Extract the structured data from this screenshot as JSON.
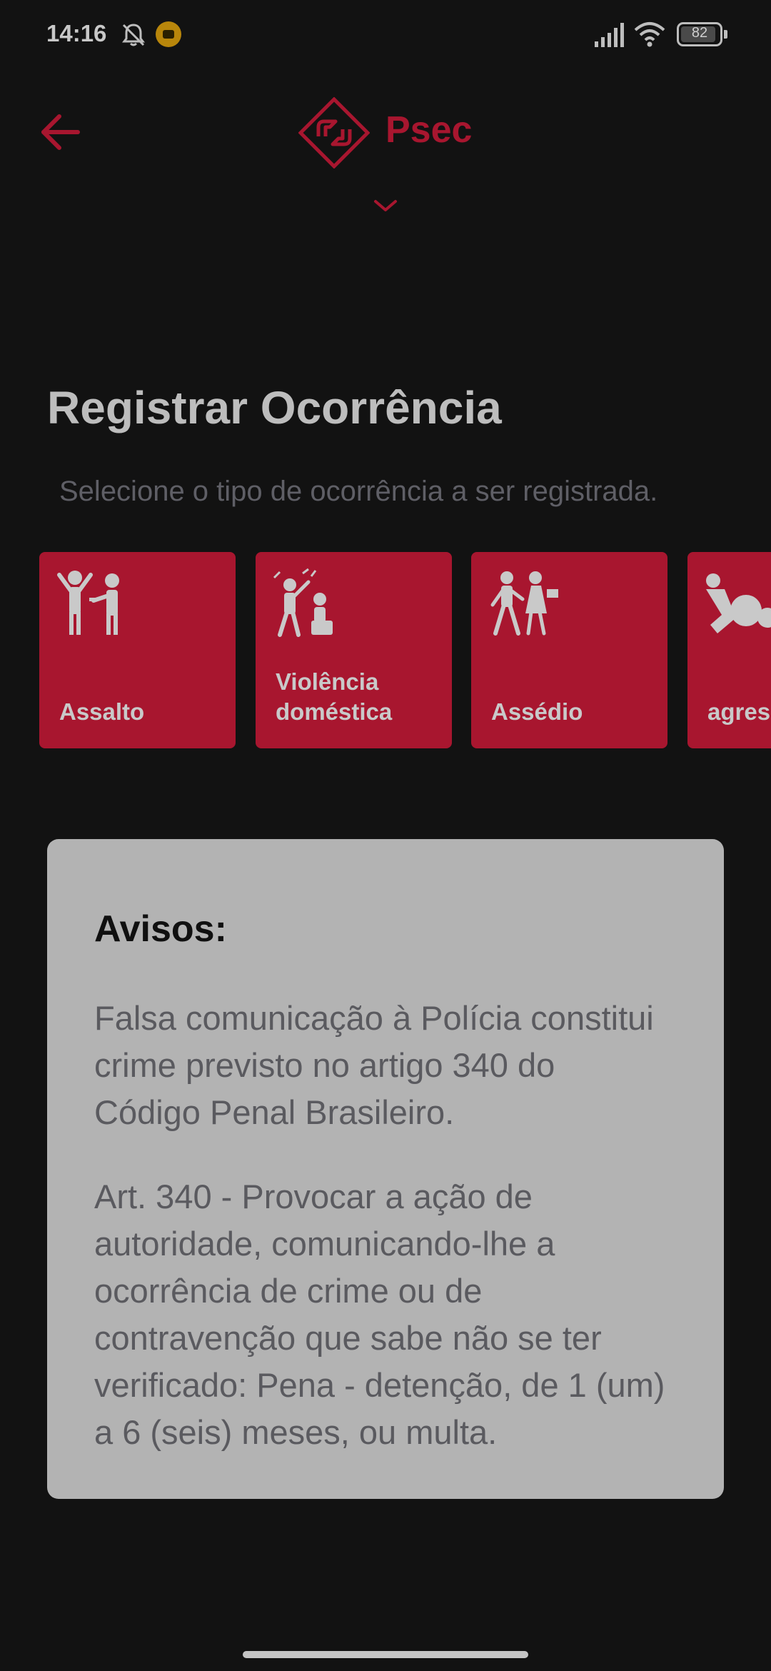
{
  "status_bar": {
    "time": "14:16",
    "battery": "82",
    "icons": [
      "bell-off-icon",
      "app-notification-icon",
      "signal-icon",
      "wifi-icon",
      "battery-icon"
    ]
  },
  "header": {
    "brand": "Psec",
    "accent_color": "#a8162f",
    "icons": [
      "back-arrow-icon",
      "psec-logo-icon",
      "chevron-down-icon"
    ]
  },
  "page": {
    "title": "Registrar Ocorrência",
    "subtitle": "Selecione o tipo de ocorrência a ser registrada."
  },
  "categories": [
    {
      "label": "Assalto",
      "icon": "assault-icon"
    },
    {
      "label": "Violência doméstica",
      "icon": "domestic-violence-icon"
    },
    {
      "label": "Assédio",
      "icon": "harassment-icon"
    },
    {
      "label": "agressão",
      "icon": "aggression-icon"
    }
  ],
  "notice": {
    "title": "Avisos:",
    "paragraph1": "Falsa comunicação à Polícia constitui crime previsto no artigo 340 do Código Penal Brasileiro.",
    "paragraph2": "Art. 340 - Provocar a ação de autoridade, comunicando-lhe a ocorrência de crime ou de contravenção que sabe não se ter verificado: Pena - detenção, de 1 (um) a 6 (seis) meses, ou multa."
  }
}
